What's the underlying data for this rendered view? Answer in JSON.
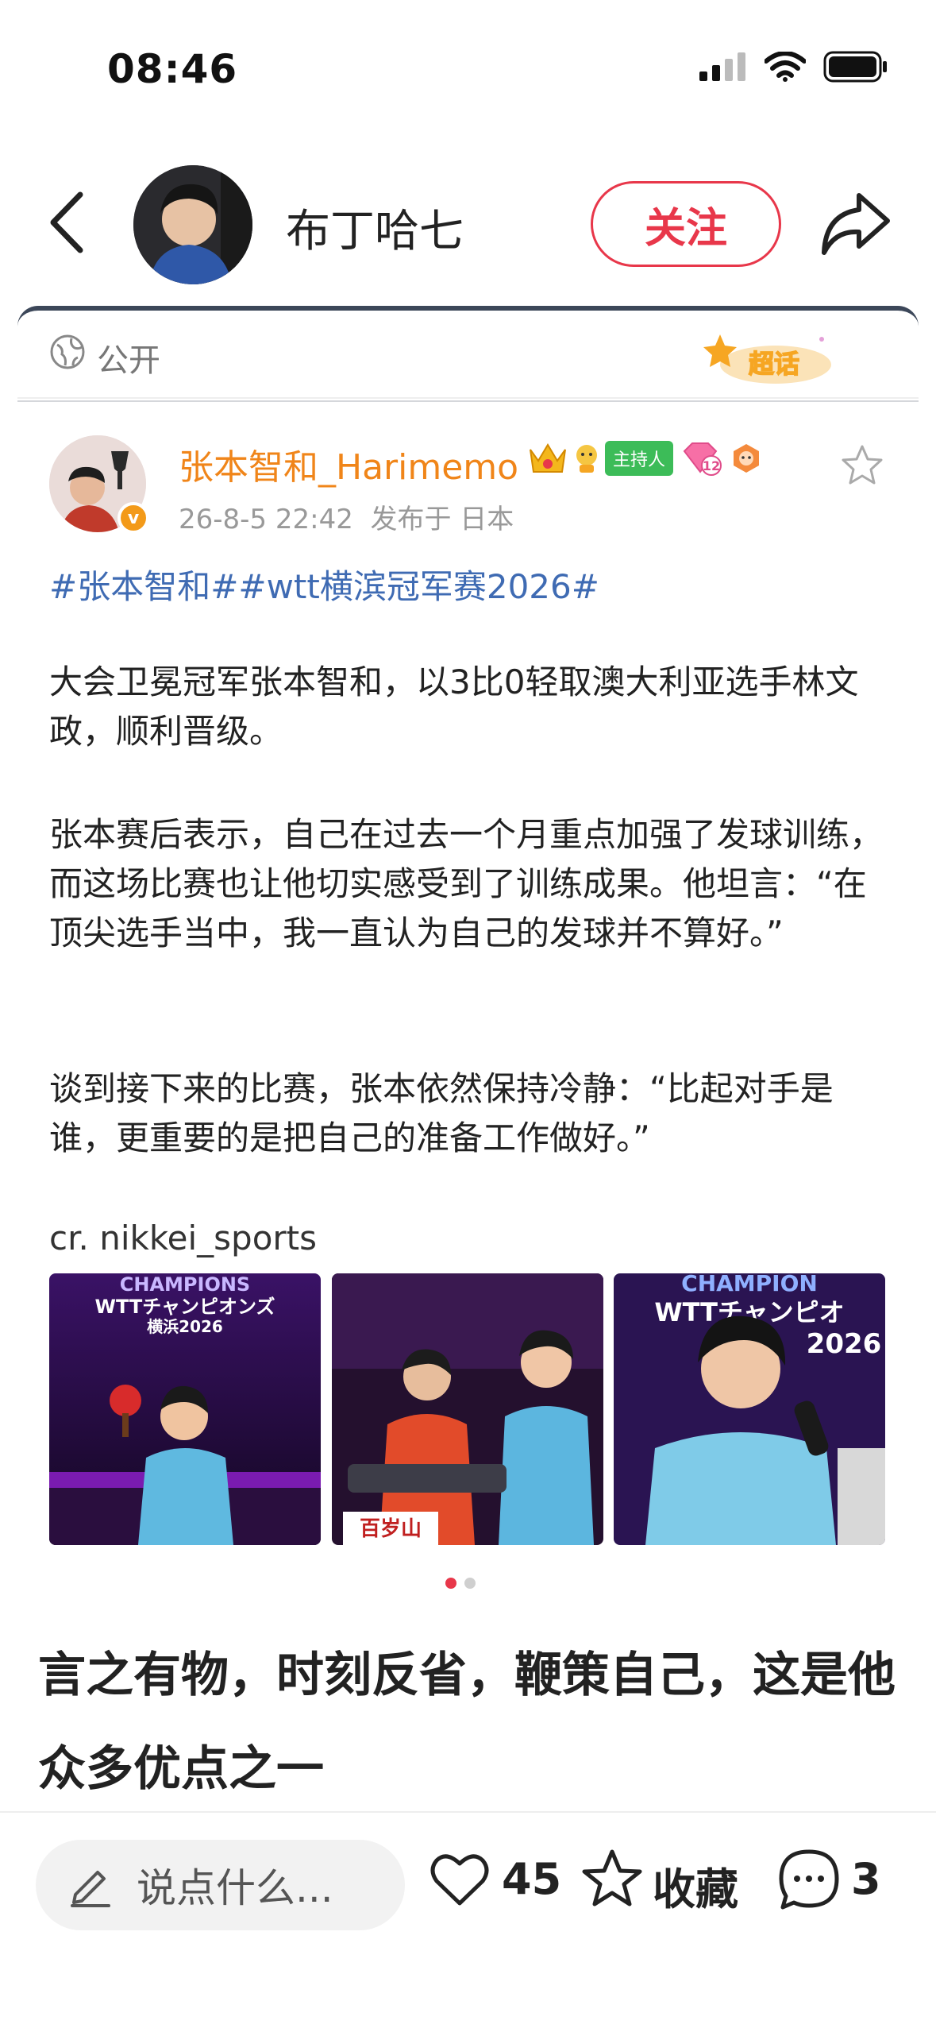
{
  "status_bar": {
    "time": "08:46",
    "icons": [
      "signal-icon",
      "wifi-icon",
      "battery-icon"
    ]
  },
  "header": {
    "author_name": "布丁哈七",
    "follow_label": "关注",
    "icons": [
      "back-icon",
      "share-icon"
    ]
  },
  "card": {
    "visibility": "公开",
    "supertopic_label": "超话"
  },
  "post": {
    "author": "张本智和_Harimemo",
    "host_badge": "主持人",
    "level_badge": "12",
    "time": "26-8-5 22:42",
    "location": "发布于 日本",
    "hashtags": "#张本智和##wtt横滨冠军赛2026#",
    "paragraphs": [
      "大会卫冕冠军张本智和，以3比0轻取澳大利亚选手林文政，顺利晋级。",
      "张本赛后表示，自己在过去一个月重点加强了发球训练，而这场比赛也让他切实感受到了训练成果。他坦言：“在顶尖选手当中，我一直认为自己的发球并不算好。”",
      "谈到接下来的比赛，张本依然保持冷静：“比起对手是谁，更重要的是把自己的准备工作做好。”"
    ],
    "credit": "cr. nikkei_sports",
    "photo1_text": [
      "CHAMPIONS",
      "WTTチャンピオンズ",
      "横浜2026"
    ],
    "photo2_text": "百岁山",
    "photo3_text": [
      "CHAMPION",
      "WTTチャンピオ",
      "2026"
    ],
    "carousel": {
      "count": 2,
      "active": 1
    }
  },
  "headline": "言之有物，时刻反省，鞭策自己，这是他众多优点之一",
  "bottom_bar": {
    "comment_placeholder": "说点什么...",
    "likes": "45",
    "collect_label": "收藏",
    "comments": "3"
  },
  "colors": {
    "accent": "#e8374a",
    "username": "#f08519",
    "hashtag": "#3f6bb3"
  }
}
